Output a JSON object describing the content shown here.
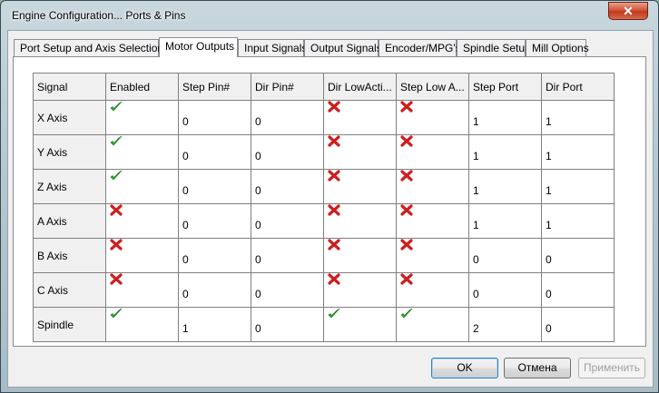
{
  "window": {
    "title": "Engine Configuration... Ports & Pins",
    "close_glyph": "✕"
  },
  "tabs": [
    {
      "label": "Port Setup and Axis Selection",
      "active": false
    },
    {
      "label": "Motor Outputs",
      "active": true
    },
    {
      "label": "Input Signals",
      "active": false
    },
    {
      "label": "Output Signals",
      "active": false
    },
    {
      "label": "Encoder/MPG's",
      "active": false
    },
    {
      "label": "Spindle Setup",
      "active": false
    },
    {
      "label": "Mill Options",
      "active": false
    }
  ],
  "grid": {
    "headers": [
      "Signal",
      "Enabled",
      "Step Pin#",
      "Dir Pin#",
      "Dir LowActi...",
      "Step Low A...",
      "Step Port",
      "Dir Port"
    ],
    "rows": [
      {
        "signal": "X Axis",
        "enabled": true,
        "step_pin": "0",
        "dir_pin": "0",
        "dir_low_active": false,
        "step_low_active": false,
        "step_port": "1",
        "dir_port": "1"
      },
      {
        "signal": "Y Axis",
        "enabled": true,
        "step_pin": "0",
        "dir_pin": "0",
        "dir_low_active": false,
        "step_low_active": false,
        "step_port": "1",
        "dir_port": "1"
      },
      {
        "signal": "Z Axis",
        "enabled": true,
        "step_pin": "0",
        "dir_pin": "0",
        "dir_low_active": false,
        "step_low_active": false,
        "step_port": "1",
        "dir_port": "1"
      },
      {
        "signal": "A Axis",
        "enabled": false,
        "step_pin": "0",
        "dir_pin": "0",
        "dir_low_active": false,
        "step_low_active": false,
        "step_port": "1",
        "dir_port": "1"
      },
      {
        "signal": "B Axis",
        "enabled": false,
        "step_pin": "0",
        "dir_pin": "0",
        "dir_low_active": false,
        "step_low_active": false,
        "step_port": "0",
        "dir_port": "0"
      },
      {
        "signal": "C Axis",
        "enabled": false,
        "step_pin": "0",
        "dir_pin": "0",
        "dir_low_active": false,
        "step_low_active": false,
        "step_port": "0",
        "dir_port": "0"
      },
      {
        "signal": "Spindle",
        "enabled": true,
        "step_pin": "1",
        "dir_pin": "0",
        "dir_low_active": true,
        "step_low_active": true,
        "step_port": "2",
        "dir_port": "0"
      }
    ]
  },
  "icons": {
    "true": "check-icon",
    "false": "x-icon"
  },
  "colors": {
    "check": "#2fb52f",
    "cross": "#cc1f1f",
    "close_button": "#c8401f"
  },
  "buttons": {
    "ok": "OK",
    "cancel": "Отмена",
    "apply": "Применить"
  }
}
